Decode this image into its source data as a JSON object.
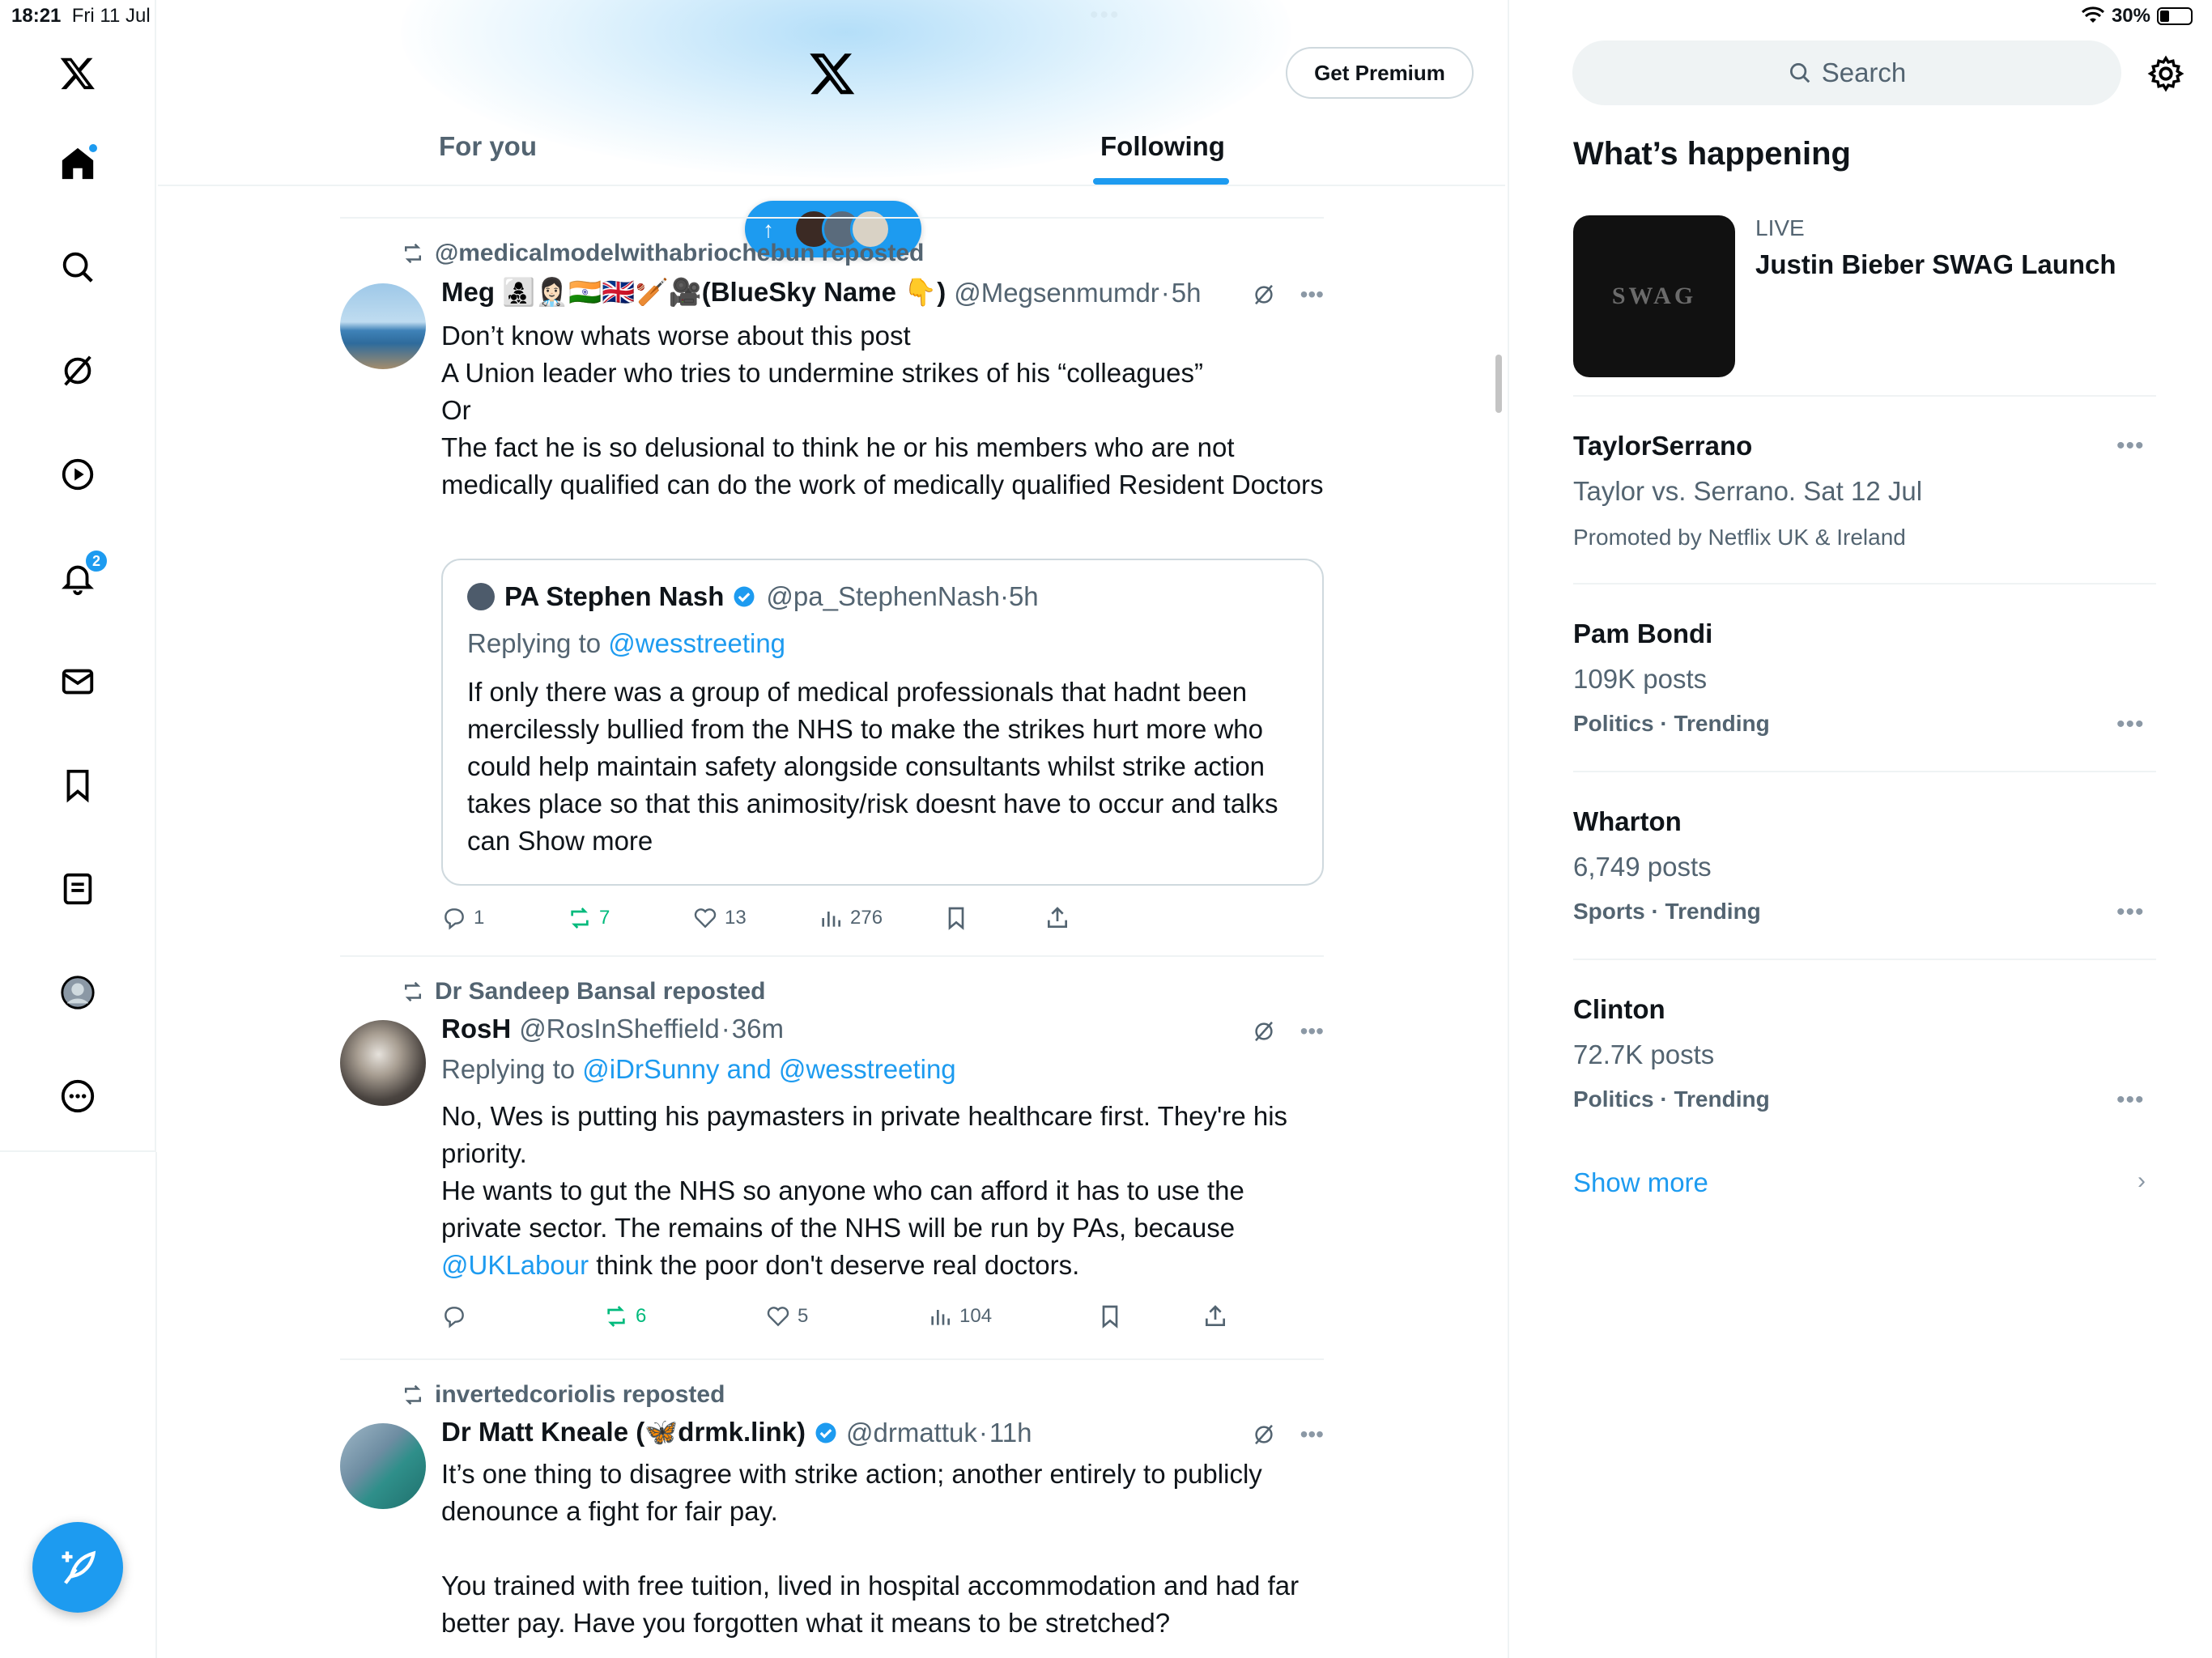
{
  "status_bar": {
    "time": "18:21",
    "date": "Fri 11 Jul",
    "battery": "30%",
    "battery_level": 0.3
  },
  "header": {
    "premium_label": "Get Premium",
    "tabs": [
      {
        "label": "For you",
        "active": false
      },
      {
        "label": "Following",
        "active": true
      }
    ]
  },
  "nav": {
    "notifications_count": "2"
  },
  "colors": {
    "accent": "#1d9bf0",
    "repost_green": "#00ba7c",
    "text_secondary": "#536471"
  },
  "feed": {
    "posts": [
      {
        "repost_by": "@medicalmodelwithabriochebun reposted",
        "name": "Meg 👩‍👧‍👦👩🏻‍⚕️🇮🇳🇬🇧🏏🎥(BlueSky Name 👇)",
        "handle": "@Megsenmumdr",
        "time": "5h",
        "text_lines": [
          "Don’t know whats worse about this post",
          "A Union leader who tries to undermine strikes of his “colleagues”",
          "Or",
          "The fact he is so delusional to think he or his members who are not medically qualified can do the work of medically qualified Resident Doctors"
        ],
        "quote": {
          "name": "PA Stephen Nash",
          "handle": "@pa_StephenNash",
          "time": "5h",
          "replying_prefix": "Replying to",
          "replying_to": "@wesstreeting",
          "text": "If only there was a group of medical professionals that hadnt been mercilessly bullied from the NHS to make the strikes hurt more who could help maintain safety alongside consultants whilst strike action takes place so that this animosity/risk doesnt have to occur and talks can Show more"
        },
        "stats": {
          "replies": "1",
          "reposts": "7",
          "likes": "13",
          "views": "276"
        }
      },
      {
        "repost_by": "Dr Sandeep Bansal reposted",
        "name": "RosH",
        "handle": "@RosInSheffield",
        "time": "36m",
        "replying_prefix": "Replying to",
        "replying_to": "@iDrSunny and @wesstreeting",
        "text_lines": [
          "No, Wes is putting his paymasters in private healthcare first. They're his priority.",
          "He wants to gut the NHS so anyone who can afford it has to use the private sector. The remains of the NHS will be run by PAs, because"
        ],
        "mention": "@UKLabour",
        "text_after_mention": " think the poor don't deserve real doctors.",
        "stats": {
          "replies": "",
          "reposts": "6",
          "likes": "5",
          "views": "104"
        }
      },
      {
        "repost_by": "invertedcoriolis reposted",
        "name": "Dr Matt Kneale (🦋drmk.link)",
        "handle": "@drmattuk",
        "time": "11h",
        "text_lines": [
          "It’s one thing to disagree with strike action; another entirely to publicly denounce a fight for fair pay.",
          "You trained with free tuition, lived in hospital accommodation and had far better pay. Have you forgotten what it means to be stretched?"
        ]
      }
    ]
  },
  "sidebar": {
    "search_placeholder": "Search",
    "title": "What’s happening",
    "live": {
      "label": "LIVE",
      "title": "Justin Bieber SWAG Launch",
      "image_text": "SWAG"
    },
    "promoted": {
      "name": "TaylorSerrano",
      "sub": "Taylor vs. Serrano. Sat 12 Jul",
      "meta": "Promoted by Netflix UK & Ireland"
    },
    "trends": [
      {
        "name": "Pam Bondi",
        "posts": "109K posts",
        "category": "Politics · Trending"
      },
      {
        "name": "Wharton",
        "posts": "6,749 posts",
        "category": "Sports · Trending"
      },
      {
        "name": "Clinton",
        "posts": "72.7K posts",
        "category": "Politics · Trending"
      }
    ],
    "show_more": "Show more"
  }
}
